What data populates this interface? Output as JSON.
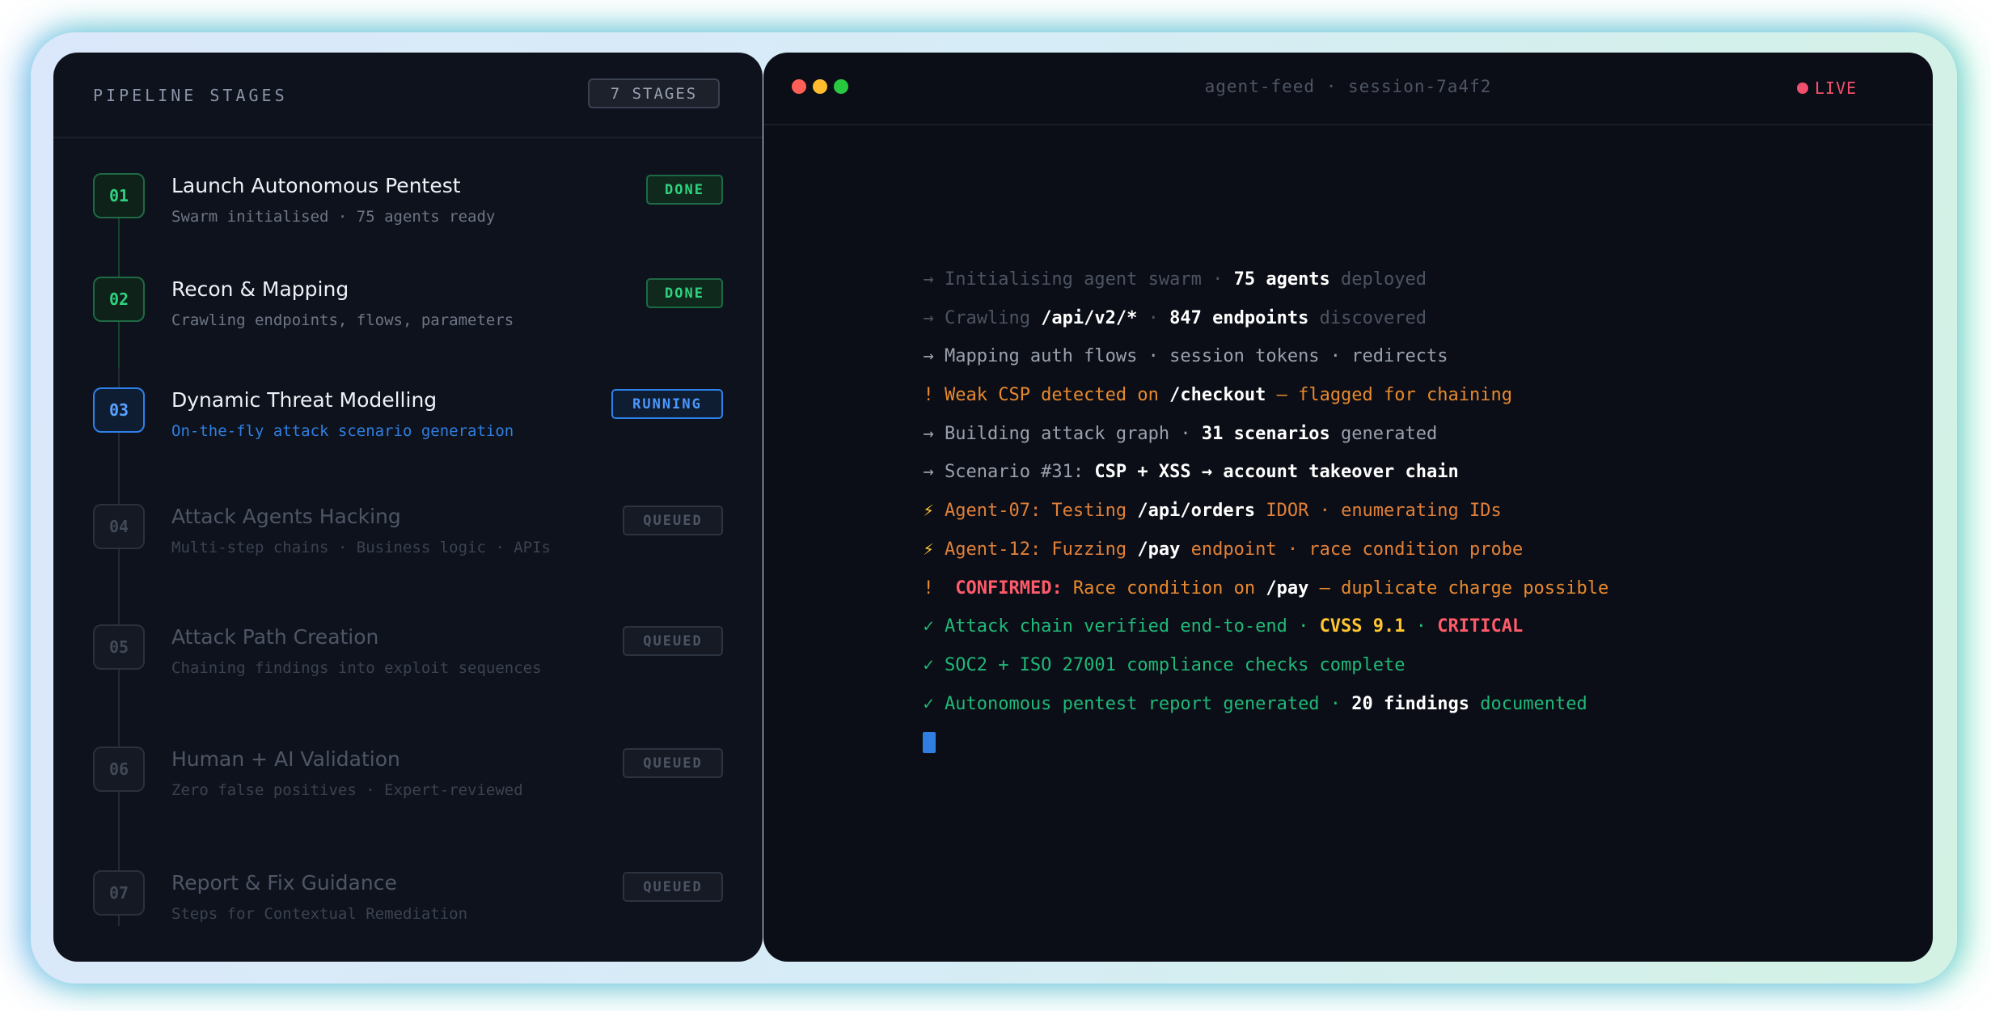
{
  "left_panel": {
    "title": "PIPELINE STAGES",
    "count_badge": "7 STAGES",
    "stages": [
      {
        "num": "01",
        "title": "Launch Autonomous Pentest",
        "subtitle": "Swarm initialised · 75 agents ready",
        "status": "DONE"
      },
      {
        "num": "02",
        "title": "Recon & Mapping",
        "subtitle": "Crawling endpoints, flows, parameters",
        "status": "DONE"
      },
      {
        "num": "03",
        "title": "Dynamic Threat Modelling",
        "subtitle": "On-the-fly attack scenario generation",
        "status": "RUNNING"
      },
      {
        "num": "04",
        "title": "Attack Agents Hacking",
        "subtitle": "Multi-step chains · Business logic · APIs",
        "status": "QUEUED"
      },
      {
        "num": "05",
        "title": "Attack Path Creation",
        "subtitle": "Chaining findings into exploit sequences",
        "status": "QUEUED"
      },
      {
        "num": "06",
        "title": "Human + AI Validation",
        "subtitle": "Zero false positives · Expert-reviewed",
        "status": "QUEUED"
      },
      {
        "num": "07",
        "title": "Report & Fix Guidance",
        "subtitle": "Steps for Contextual Remediation",
        "status": "QUEUED"
      }
    ]
  },
  "terminal": {
    "title": "agent-feed · session-7a4f2",
    "live_label": "LIVE",
    "lines": [
      [
        [
          "dim",
          "→ Initialising agent swarm · "
        ],
        [
          "w",
          "75 agents"
        ],
        [
          "dim",
          " deployed"
        ]
      ],
      [
        [
          "dim",
          "→ Crawling "
        ],
        [
          "w",
          "/api/v2/*"
        ],
        [
          "dim",
          " · "
        ],
        [
          "w",
          "847 endpoints"
        ],
        [
          "dim",
          " discovered"
        ]
      ],
      [
        [
          "grey",
          "→ Mapping auth flows · session tokens · redirects"
        ]
      ],
      [
        [
          "or",
          "! Weak CSP detected on "
        ],
        [
          "w",
          "/checkout"
        ],
        [
          "or",
          " — flagged for chaining"
        ]
      ],
      [
        [
          "grey",
          "→ Building attack graph · "
        ],
        [
          "w",
          "31 scenarios"
        ],
        [
          "grey",
          " generated"
        ]
      ],
      [
        [
          "grey",
          "→ Scenario #31: "
        ],
        [
          "w",
          "CSP + XSS → account takeover chain"
        ]
      ],
      [
        [
          "yel",
          "⚡ "
        ],
        [
          "org",
          "Agent-07: Testing "
        ],
        [
          "w",
          "/api/orders"
        ],
        [
          "org",
          " IDOR · enumerating IDs"
        ]
      ],
      [
        [
          "yel",
          "⚡ "
        ],
        [
          "org",
          "Agent-12: Fuzzing "
        ],
        [
          "w",
          "/pay"
        ],
        [
          "org",
          " endpoint · race condition probe"
        ]
      ],
      [
        [
          "or",
          "!  "
        ],
        [
          "red",
          "CONFIRMED:"
        ],
        [
          "or",
          " Race condition on "
        ],
        [
          "w",
          "/pay"
        ],
        [
          "or",
          " — duplicate charge possible"
        ]
      ],
      [
        [
          "grn",
          "✓ Attack chain verified end-to-end · "
        ],
        [
          "yel",
          "CVSS 9.1"
        ],
        [
          "grn",
          " · "
        ],
        [
          "red",
          "CRITICAL"
        ]
      ],
      [
        [
          "grn",
          "✓ SOC2 + ISO 27001 compliance checks complete"
        ]
      ],
      [
        [
          "grn",
          "✓ Autonomous pentest report generated · "
        ],
        [
          "w",
          "20 findings"
        ],
        [
          "grn",
          " documented"
        ]
      ]
    ]
  },
  "colors": {
    "done": "#2fd27e",
    "running": "#2f80ea",
    "live": "#f0506e",
    "warning": "#e8892f",
    "success": "#1fb978",
    "critical": "#ff5b6a",
    "cvss": "#ffc62f"
  }
}
